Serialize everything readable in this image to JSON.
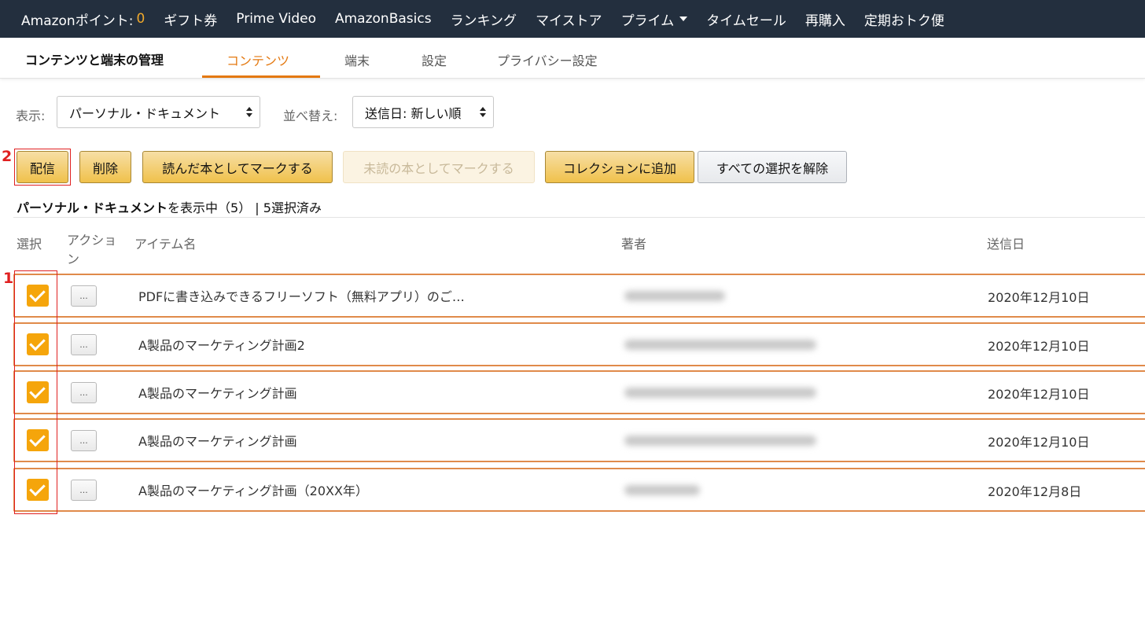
{
  "top_nav": {
    "points_label": "Amazonポイント:",
    "points_value": "0",
    "items": [
      "ギフト券",
      "Prime Video",
      "AmazonBasics",
      "ランキング",
      "マイストア"
    ],
    "prime_label": "プライム",
    "items_after": [
      "タイムセール",
      "再購入",
      "定期おトク便"
    ]
  },
  "sub_nav": {
    "section_title": "コンテンツと端末の管理",
    "tabs": [
      "コンテンツ",
      "端末",
      "設定",
      "プライバシー設定"
    ]
  },
  "filters": {
    "show_label": "表示:",
    "show_value": "パーソナル・ドキュメント",
    "sort_label": "並べ替え:",
    "sort_value": "送信日: 新しい順"
  },
  "actions": {
    "deliver": "配信",
    "delete": "削除",
    "mark_read": "読んだ本としてマークする",
    "mark_unread": "未読の本としてマークする",
    "add_collection": "コレクションに追加",
    "deselect_all": "すべての選択を解除"
  },
  "summary": {
    "category": "パーソナル・ドキュメント",
    "showing": "を表示中（5）",
    "selected": "| 5選択済み"
  },
  "table": {
    "headers": {
      "select": "選択",
      "action": "アクション",
      "item_name": "アイテム名",
      "author": "著者",
      "sent_date": "送信日"
    },
    "more_button": "...",
    "rows": [
      {
        "title": "PDFに書き込みできるフリーソフト（無料アプリ）のご…",
        "date": "2020年12月10日",
        "checked": true
      },
      {
        "title": "A製品のマーケティング計画2",
        "date": "2020年12月10日",
        "checked": true
      },
      {
        "title": "A製品のマーケティング計画",
        "date": "2020年12月10日",
        "checked": true
      },
      {
        "title": "A製品のマーケティング計画",
        "date": "2020年12月10日",
        "checked": true
      },
      {
        "title": "A製品のマーケティング計画（20XX年）",
        "date": "2020年12月8日",
        "checked": true
      }
    ]
  },
  "annotations": {
    "marker_1": "1",
    "marker_2": "2"
  },
  "colors": {
    "nav_bg": "#232f3e",
    "accent_orange": "#e47911",
    "checkbox": "#f5a50b",
    "highlight_red": "#e02020"
  }
}
